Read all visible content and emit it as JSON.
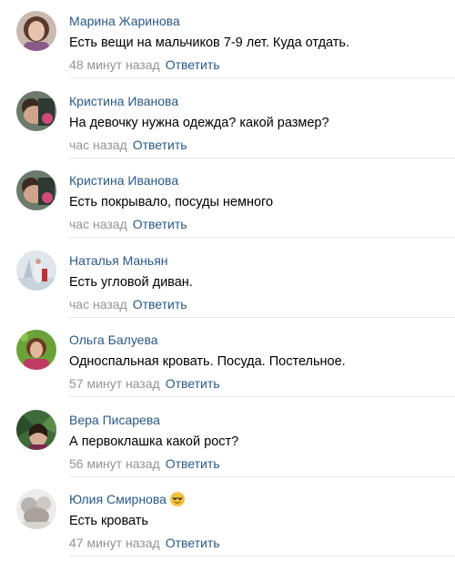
{
  "reply_label": "Ответить",
  "colors": {
    "link": "#2a5885",
    "meta": "#939393",
    "divider": "#e7e8ec"
  },
  "comments": [
    {
      "author": "Марина Жаринова",
      "text": "Есть вещи на мальчиков 7-9 лет. Куда отдать.",
      "time": "48 минут назад",
      "avatar": "avatar-marina"
    },
    {
      "author": "Кристина Иванова",
      "text": "На девочку нужна одежда? какой размер?",
      "time": "час назад",
      "avatar": "avatar-kristina"
    },
    {
      "author": "Кристина Иванова",
      "text": "Есть покрывало, посуды немного",
      "time": "час назад",
      "avatar": "avatar-kristina"
    },
    {
      "author": "Наталья Маньян",
      "text": "Есть угловой диван.",
      "time": "час назад",
      "avatar": "avatar-natalya"
    },
    {
      "author": "Ольга Балуева",
      "text": "Односпальная кровать. Посуда. Постельное.",
      "time": "57 минут назад",
      "avatar": "avatar-olga"
    },
    {
      "author": "Вера Писарева",
      "text": "А первоклашка какой рост?",
      "time": "56 минут назад",
      "avatar": "avatar-vera"
    },
    {
      "author": "Юлия Смирнова",
      "text": "Есть кровать",
      "time": "47 минут назад",
      "avatar": "avatar-yulia",
      "author_emoji": "smiling-sunglasses-emoji"
    }
  ]
}
